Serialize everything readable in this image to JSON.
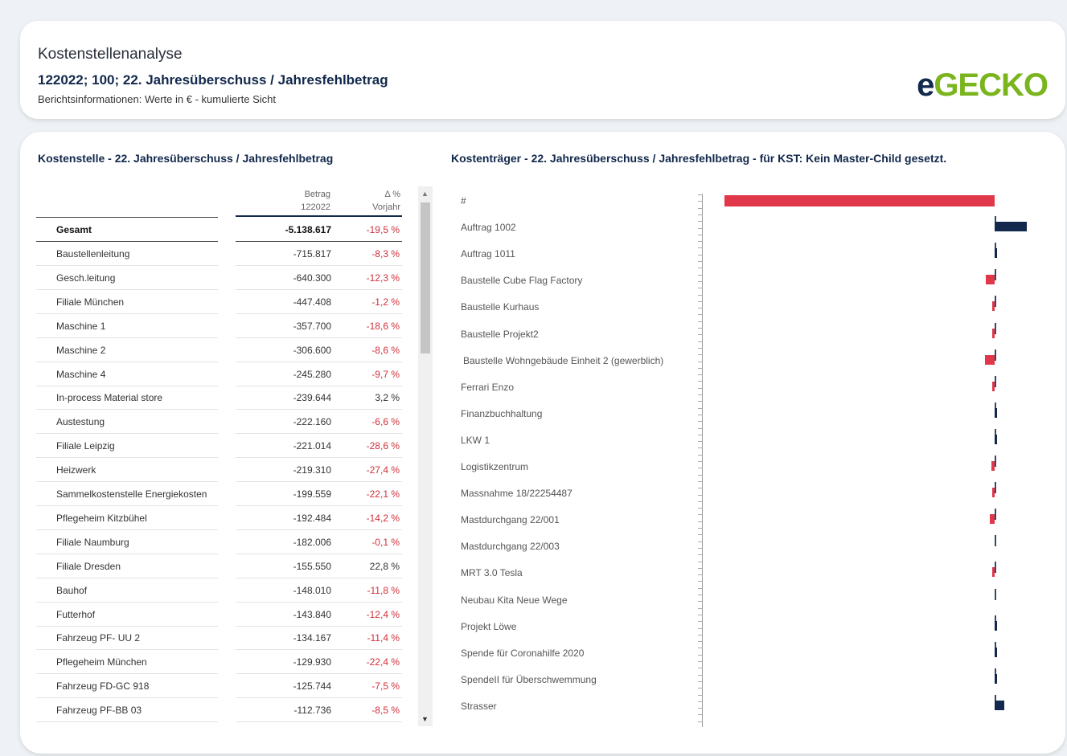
{
  "header": {
    "title": "Kostenstellenanalyse",
    "subtitle": "122022; 100; 22. Jahresüberschuss / Jahresfehlbetrag",
    "info": "Berichtsinformationen: Werte in € - kumulierte Sicht",
    "logo_e": "e",
    "logo_rest": "GECKO"
  },
  "left": {
    "title": "Kostenstelle - 22. Jahresüberschuss / Jahresfehlbetrag",
    "col_betrag": "Betrag",
    "col_betrag_sub": "122022",
    "col_delta": "Δ %",
    "col_delta_sub": "Vorjahr",
    "total": {
      "name": "Gesamt",
      "value": "-5.138.617",
      "pct": "-19,5 %"
    },
    "rows": [
      {
        "name": "Baustellenleitung",
        "value": "-715.817",
        "pct": "-8,3 %"
      },
      {
        "name": "Gesch.leitung",
        "value": "-640.300",
        "pct": "-12,3 %"
      },
      {
        "name": "Filiale München",
        "value": "-447.408",
        "pct": "-1,2 %"
      },
      {
        "name": "Maschine 1",
        "value": "-357.700",
        "pct": "-18,6 %"
      },
      {
        "name": "Maschine 2",
        "value": "-306.600",
        "pct": "-8,6 %"
      },
      {
        "name": "Maschine 4",
        "value": "-245.280",
        "pct": "-9,7 %"
      },
      {
        "name": "In-process Material store",
        "value": "-239.644",
        "pct": "3,2 %"
      },
      {
        "name": "Austestung",
        "value": "-222.160",
        "pct": "-6,6 %"
      },
      {
        "name": "Filiale Leipzig",
        "value": "-221.014",
        "pct": "-28,6 %"
      },
      {
        "name": "Heizwerk",
        "value": "-219.310",
        "pct": "-27,4 %"
      },
      {
        "name": "Sammelkostenstelle Energiekosten",
        "value": "-199.559",
        "pct": "-22,1 %"
      },
      {
        "name": "Pflegeheim Kitzbühel",
        "value": "-192.484",
        "pct": "-14,2 %"
      },
      {
        "name": "Filiale Naumburg",
        "value": "-182.006",
        "pct": "-0,1 %"
      },
      {
        "name": "Filiale Dresden",
        "value": "-155.550",
        "pct": "22,8 %"
      },
      {
        "name": "Bauhof",
        "value": "-148.010",
        "pct": "-11,8 %"
      },
      {
        "name": "Futterhof",
        "value": "-143.840",
        "pct": "-12,4 %"
      },
      {
        "name": "Fahrzeug PF- UU 2",
        "value": "-134.167",
        "pct": "-11,4 %"
      },
      {
        "name": "Pflegeheim München",
        "value": "-129.930",
        "pct": "-22,4 %"
      },
      {
        "name": "Fahrzeug FD-GC 918",
        "value": "-125.744",
        "pct": "-7,5 %"
      },
      {
        "name": "Fahrzeug PF-BB 03",
        "value": "-112.736",
        "pct": "-8,5 %"
      }
    ]
  },
  "right": {
    "title": "Kostenträger - 22. Jahresüberschuss / Jahresfehlbetrag - für KST: Kein Master-Child gesetzt."
  },
  "colors": {
    "negative": "#e0384a",
    "positive": "#12284c"
  },
  "chart_data": {
    "type": "bar",
    "orientation": "horizontal",
    "categories": [
      "#",
      "Auftrag 1002",
      "Auftrag 1011",
      "Baustelle Cube Flag Factory",
      "Baustelle Kurhaus",
      "Baustelle Projekt2",
      "Baustelle Wohngebäude Einheit 2 (gewerblich)",
      "Ferrari Enzo",
      "Finanzbuchhaltung",
      "LKW 1",
      "Logistikzentrum",
      "Massnahme 18/22254487",
      "Mastdurchgang 22/001",
      "Mastdurchgang 22/003",
      "MRT 3.0 Tesla",
      "Neubau Kita Neue Wege",
      "Projekt Löwe",
      "Spende  für Coronahilfe 2020",
      "SpendeII  für Überschwemmung",
      "Strasser"
    ],
    "values": [
      -3400000,
      400000,
      20000,
      -110000,
      -25000,
      -20000,
      -120000,
      -10000,
      15000,
      20000,
      -45000,
      -5000,
      -60000,
      0,
      -35000,
      0,
      10000,
      10000,
      15000,
      120000
    ],
    "xlabel": "",
    "ylabel": ""
  }
}
